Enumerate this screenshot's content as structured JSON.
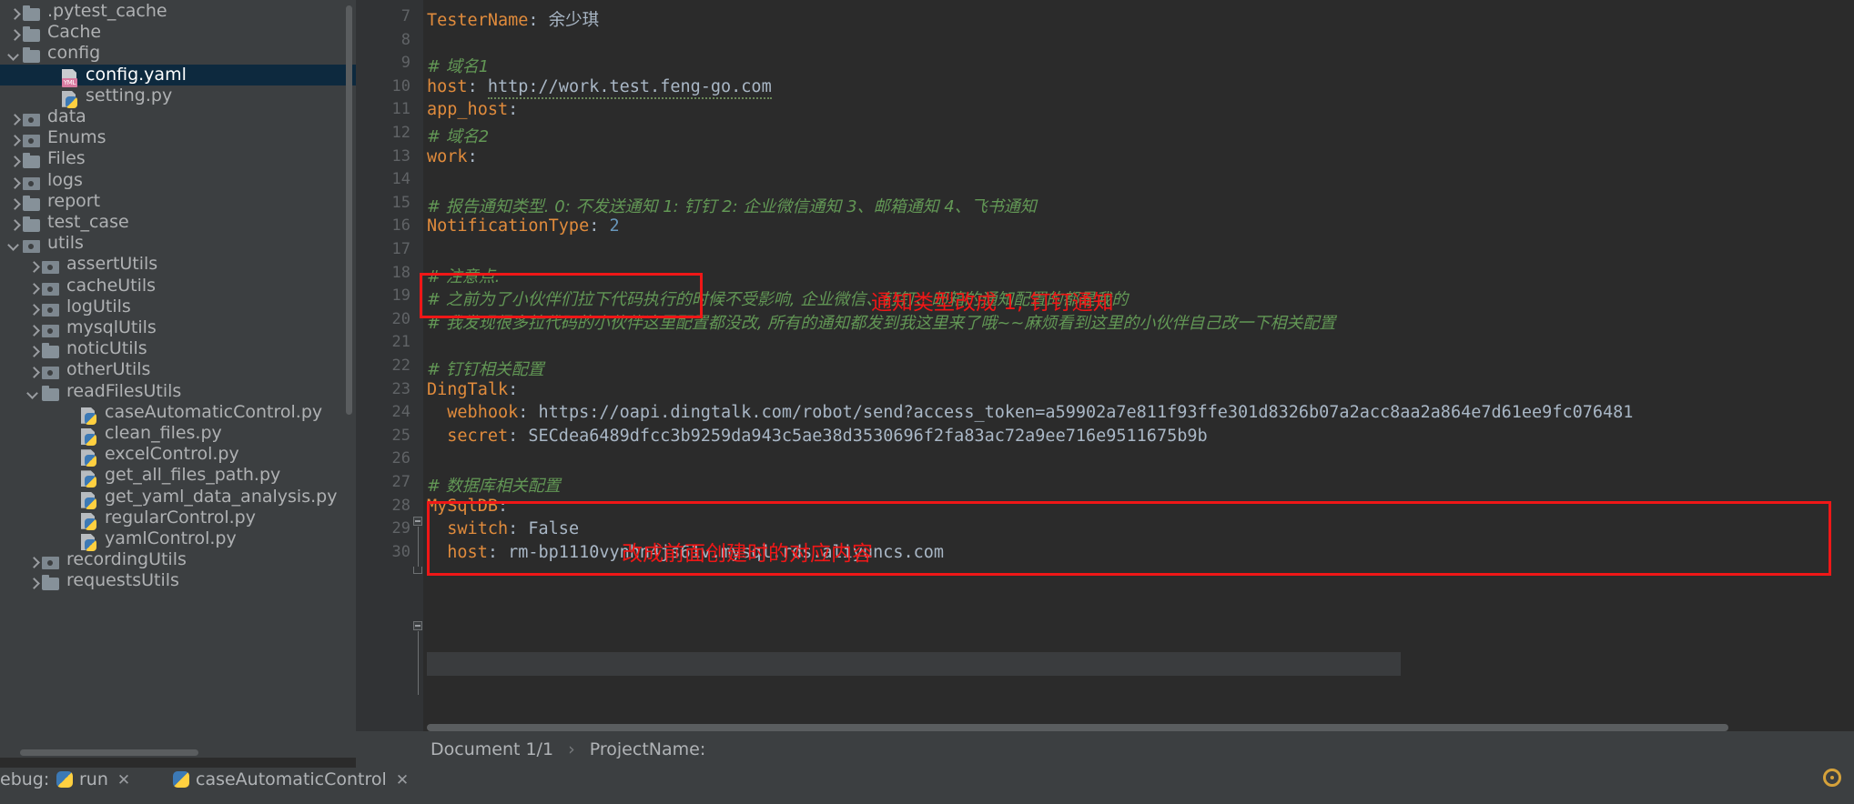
{
  "sidebar": {
    "items": [
      {
        "label": ".pytest_cache",
        "icon": "folder-icon",
        "arrow": "right",
        "indent": 0,
        "type": "folder",
        "selected": false
      },
      {
        "label": "Cache",
        "icon": "folder-icon",
        "arrow": "right",
        "indent": 0,
        "type": "folder",
        "selected": false
      },
      {
        "label": "config",
        "icon": "folder-icon",
        "arrow": "down",
        "indent": 0,
        "type": "folder",
        "selected": false
      },
      {
        "label": "config.yaml",
        "icon": "yaml-file-icon",
        "arrow": "none",
        "indent": 2,
        "type": "yml",
        "selected": true
      },
      {
        "label": "setting.py",
        "icon": "python-file-icon",
        "arrow": "none",
        "indent": 2,
        "type": "py",
        "selected": false
      },
      {
        "label": "data",
        "icon": "source-folder-icon",
        "arrow": "right",
        "indent": 0,
        "type": "folder-src",
        "selected": false
      },
      {
        "label": "Enums",
        "icon": "source-folder-icon",
        "arrow": "right",
        "indent": 0,
        "type": "folder-src",
        "selected": false
      },
      {
        "label": "Files",
        "icon": "folder-icon",
        "arrow": "right",
        "indent": 0,
        "type": "folder",
        "selected": false
      },
      {
        "label": "logs",
        "icon": "source-folder-icon",
        "arrow": "right",
        "indent": 0,
        "type": "folder-src",
        "selected": false
      },
      {
        "label": "report",
        "icon": "folder-icon",
        "arrow": "right",
        "indent": 0,
        "type": "folder",
        "selected": false
      },
      {
        "label": "test_case",
        "icon": "folder-icon",
        "arrow": "right",
        "indent": 0,
        "type": "folder",
        "selected": false
      },
      {
        "label": "utils",
        "icon": "source-folder-icon",
        "arrow": "down",
        "indent": 0,
        "type": "folder-src",
        "selected": false
      },
      {
        "label": "assertUtils",
        "icon": "source-folder-icon",
        "arrow": "right",
        "indent": 1,
        "type": "folder-src",
        "selected": false
      },
      {
        "label": "cacheUtils",
        "icon": "source-folder-icon",
        "arrow": "right",
        "indent": 1,
        "type": "folder-src",
        "selected": false
      },
      {
        "label": "logUtils",
        "icon": "source-folder-icon",
        "arrow": "right",
        "indent": 1,
        "type": "folder-src",
        "selected": false
      },
      {
        "label": "mysqlUtils",
        "icon": "source-folder-icon",
        "arrow": "right",
        "indent": 1,
        "type": "folder-src",
        "selected": false
      },
      {
        "label": "noticUtils",
        "icon": "folder-icon",
        "arrow": "right",
        "indent": 1,
        "type": "folder",
        "selected": false
      },
      {
        "label": "otherUtils",
        "icon": "source-folder-icon",
        "arrow": "right",
        "indent": 1,
        "type": "folder-src",
        "selected": false
      },
      {
        "label": "readFilesUtils",
        "icon": "folder-icon",
        "arrow": "down",
        "indent": 1,
        "type": "folder",
        "selected": false
      },
      {
        "label": "caseAutomaticControl.py",
        "icon": "python-file-icon",
        "arrow": "none",
        "indent": 3,
        "type": "py",
        "selected": false
      },
      {
        "label": "clean_files.py",
        "icon": "python-file-icon",
        "arrow": "none",
        "indent": 3,
        "type": "py",
        "selected": false
      },
      {
        "label": "excelControl.py",
        "icon": "python-file-icon",
        "arrow": "none",
        "indent": 3,
        "type": "py",
        "selected": false
      },
      {
        "label": "get_all_files_path.py",
        "icon": "python-file-icon",
        "arrow": "none",
        "indent": 3,
        "type": "py",
        "selected": false
      },
      {
        "label": "get_yaml_data_analysis.py",
        "icon": "python-file-icon",
        "arrow": "none",
        "indent": 3,
        "type": "py",
        "selected": false
      },
      {
        "label": "regularControl.py",
        "icon": "python-file-icon",
        "arrow": "none",
        "indent": 3,
        "type": "py",
        "selected": false
      },
      {
        "label": "yamlControl.py",
        "icon": "python-file-icon",
        "arrow": "none",
        "indent": 3,
        "type": "py",
        "selected": false
      },
      {
        "label": "recordingUtils",
        "icon": "source-folder-icon",
        "arrow": "right",
        "indent": 1,
        "type": "folder-src",
        "selected": false
      },
      {
        "label": "requestsUtils",
        "icon": "folder-icon",
        "arrow": "right",
        "indent": 1,
        "type": "folder",
        "selected": false
      }
    ]
  },
  "editor": {
    "lines": [
      {
        "no": "7",
        "parts": [
          {
            "t": "TesterName",
            "c": "kk"
          },
          {
            "t": ": ",
            "c": "punct"
          },
          {
            "t": "余少琪",
            "c": "s chn"
          }
        ]
      },
      {
        "no": "8",
        "parts": []
      },
      {
        "no": "9",
        "parts": [
          {
            "t": "# 域名1",
            "c": "cm"
          }
        ]
      },
      {
        "no": "10",
        "parts": [
          {
            "t": "host",
            "c": "kk"
          },
          {
            "t": ": ",
            "c": "punct"
          },
          {
            "t": "http://work.test.feng-go.com",
            "c": "s squiggle"
          }
        ]
      },
      {
        "no": "11",
        "parts": [
          {
            "t": "app_host",
            "c": "kk"
          },
          {
            "t": ":",
            "c": "punct"
          }
        ]
      },
      {
        "no": "12",
        "parts": [
          {
            "t": "# 域名2",
            "c": "cm"
          }
        ]
      },
      {
        "no": "13",
        "parts": [
          {
            "t": "work",
            "c": "kk"
          },
          {
            "t": ":",
            "c": "punct"
          }
        ]
      },
      {
        "no": "14",
        "parts": []
      },
      {
        "no": "15",
        "parts": [
          {
            "t": "# 报告通知类型. 0: 不发送通知 1: 钉钉 2: 企业微信通知 3、邮箱通知 4、飞书通知",
            "c": "cm"
          }
        ]
      },
      {
        "no": "16",
        "parts": [
          {
            "t": "NotificationType",
            "c": "kk"
          },
          {
            "t": ": ",
            "c": "punct"
          },
          {
            "t": "2",
            "c": "num"
          }
        ]
      },
      {
        "no": "17",
        "parts": []
      },
      {
        "no": "18",
        "parts": [
          {
            "t": "# 注意点:",
            "c": "cm"
          }
        ]
      },
      {
        "no": "19",
        "parts": [
          {
            "t": "# 之前为了小伙伴们拉下代码执行的时候不受影响, 企业微信、钉钉、邮箱的通知配置的都是我的",
            "c": "cm"
          }
        ]
      },
      {
        "no": "20",
        "parts": [
          {
            "t": "# 我发现很多拉代码的小伙伴这里配置都没改, 所有的通知都发到我这里来了哦~~麻烦看到这里的小伙伴自己改一下相关配置",
            "c": "cm"
          }
        ]
      },
      {
        "no": "21",
        "parts": []
      },
      {
        "no": "22",
        "parts": [
          {
            "t": "# 钉钉相关配置",
            "c": "cm"
          }
        ]
      },
      {
        "no": "23",
        "parts": [
          {
            "t": "DingTalk",
            "c": "kk"
          },
          {
            "t": ":",
            "c": "punct"
          }
        ]
      },
      {
        "no": "24",
        "parts": [
          {
            "t": "  webhook",
            "c": "kk"
          },
          {
            "t": ": ",
            "c": "punct"
          },
          {
            "t": "https://oapi.dingtalk.com/robot/send?access_token=a59902a7e811f93ffe301d8326b07a2acc8aa2a864e7d61ee9fc076481",
            "c": "s"
          }
        ]
      },
      {
        "no": "25",
        "parts": [
          {
            "t": "  secret",
            "c": "kk"
          },
          {
            "t": ": ",
            "c": "punct"
          },
          {
            "t": "SECdea6489dfcc3b9259da943c5ae38d3530696f2fa83ac72a9ee716e9511675b9b",
            "c": "s"
          }
        ]
      },
      {
        "no": "26",
        "parts": []
      },
      {
        "no": "27",
        "parts": [
          {
            "t": "# 数据库相关配置",
            "c": "cm"
          }
        ]
      },
      {
        "no": "28",
        "parts": [
          {
            "t": "MySqlDB",
            "c": "kk"
          },
          {
            "t": ":",
            "c": "punct"
          }
        ]
      },
      {
        "no": "29",
        "parts": [
          {
            "t": "  switch",
            "c": "kk"
          },
          {
            "t": ": ",
            "c": "punct"
          },
          {
            "t": "False",
            "c": "s"
          }
        ]
      },
      {
        "no": "30",
        "parts": [
          {
            "t": "  host",
            "c": "kk"
          },
          {
            "t": ": ",
            "c": "punct"
          },
          {
            "t": "rm-bp1110vynhn4js61v.mysql.rds.aliyuncs.com",
            "c": "s"
          }
        ]
      }
    ],
    "annotations": [
      {
        "text": "通知类型改成 1, 钉钉通知",
        "color": "#ef1717"
      },
      {
        "text": "改成前面创建时的对应内容",
        "color": "#ef1717"
      }
    ]
  },
  "breadcrumb": {
    "document": "Document 1/1",
    "separator": "›",
    "node": "ProjectName:"
  },
  "bottombar": {
    "debug_label": "ebug:",
    "run_tab": "run",
    "case_tab": "caseAutomaticControl",
    "close_glyph": "✕"
  },
  "colors": {
    "accent_red": "#ef1717",
    "selection_blue": "#0d293e",
    "comment_green": "#629755",
    "key_orange": "#e08b3c",
    "string_grey": "#a9b7c6",
    "number_blue": "#6897bb",
    "editor_bg": "#2b2b2b",
    "panel_bg": "#3c3f41"
  }
}
